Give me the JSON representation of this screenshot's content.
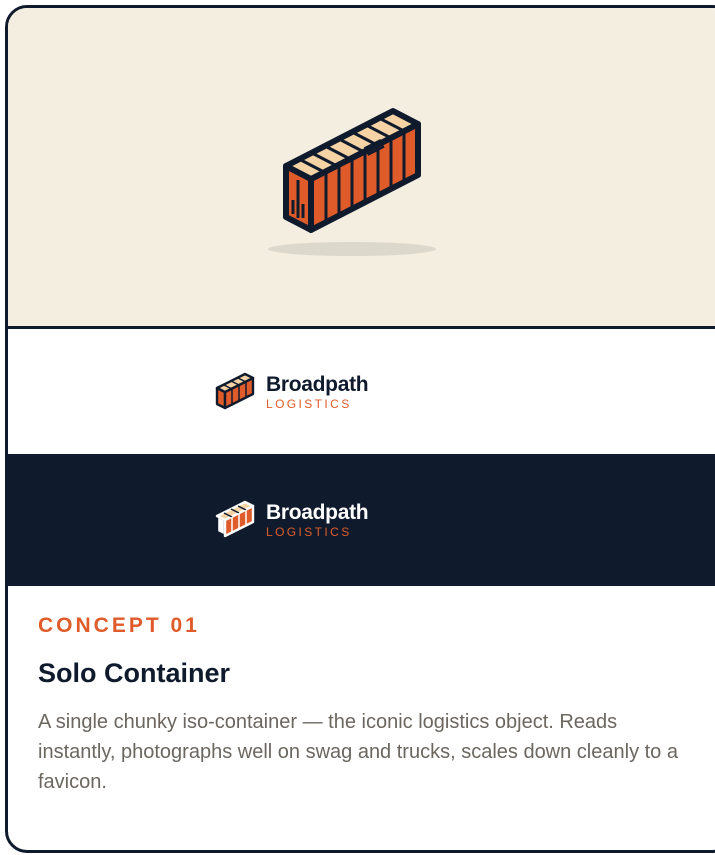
{
  "colors": {
    "navy": "#0f1b2d",
    "orange": "#e05b2a",
    "cream": "#f4eee1",
    "roof": "#f6d3a4",
    "shadow": "#dcd8cb",
    "muted_text": "#6b6660"
  },
  "hero": {
    "illustration": "iso-container-icon"
  },
  "logo_light": {
    "name": "Broadpath",
    "sub": "LOGISTICS"
  },
  "logo_dark": {
    "name": "Broadpath",
    "sub": "LOGISTICS"
  },
  "concept": {
    "label": "CONCEPT 01",
    "title": "Solo Container",
    "description": "A single chunky iso-container — the iconic logistics object. Reads instantly, photographs well on swag and trucks, scales down cleanly to a favicon."
  }
}
